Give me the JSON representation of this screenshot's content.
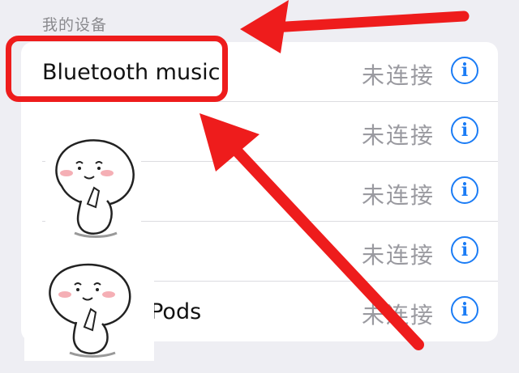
{
  "section": {
    "title": "我的设备"
  },
  "devices": [
    {
      "name": "Bluetooth music",
      "status": "未连接",
      "info_icon": "info-circle-icon"
    },
    {
      "name": "",
      "status": "未连接",
      "info_icon": "info-circle-icon"
    },
    {
      "name": "",
      "status": "未连接",
      "info_icon": "info-circle-icon"
    },
    {
      "name": "",
      "status": "未连接",
      "info_icon": "info-circle-icon"
    },
    {
      "name": "rPods",
      "status": "未连接",
      "info_icon": "info-circle-icon"
    }
  ],
  "colors": {
    "accent": "#1b7cf5",
    "annotation_red": "#ee1c1c",
    "status_gray": "#9a9aa0",
    "background": "#eeeef3"
  },
  "icons": {
    "info": "info-circle-icon",
    "overlay_sticker": "blob-sticker-icon"
  }
}
